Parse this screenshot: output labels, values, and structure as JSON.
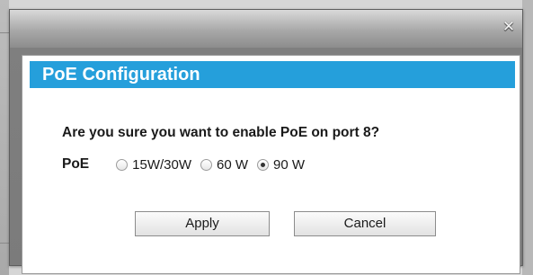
{
  "dialog": {
    "close_glyph": "✕",
    "header_title": "PoE Configuration",
    "question": "Are you sure you want to enable PoE on port 8?",
    "poe_label": "PoE",
    "options": [
      {
        "label": "15W/30W",
        "selected": false
      },
      {
        "label": "60 W",
        "selected": false
      },
      {
        "label": "90 W",
        "selected": true
      }
    ],
    "apply_label": "Apply",
    "cancel_label": "Cancel"
  },
  "colors": {
    "header_bar": "#259fdb",
    "header_text": "#ffffff",
    "content_bg": "#ffffff"
  }
}
